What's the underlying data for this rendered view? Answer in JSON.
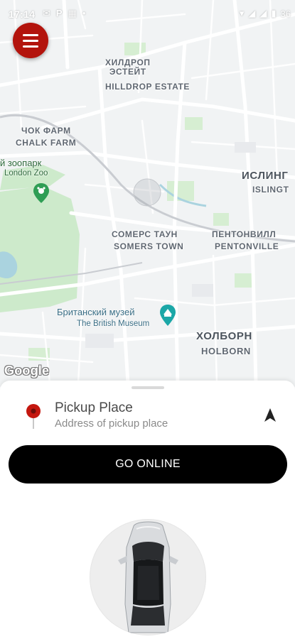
{
  "status_bar": {
    "time": "17:14",
    "left_icons": [
      "mail-icon",
      "parking-icon",
      "calendar-icon",
      "dot-icon"
    ],
    "right_icons": [
      "wifi-icon",
      "signal-icon",
      "battery-icon"
    ],
    "battery": "36"
  },
  "map": {
    "labels": {
      "hilldrop_ru": "ХИЛДРОП\nЭСТЕЙТ",
      "hilldrop_en": "HILLDROP ESTATE",
      "chalk_ru": "ЧОК ФАРМ",
      "chalk_en": "CHALK FARM",
      "zoo_ru": "й зоопарк",
      "zoo_en": "London Zoo",
      "islington_ru": "ИСЛИНГ",
      "islington_en": "ISLINGT",
      "somers_ru": "СОМЕРС ТАУН",
      "somers_en": "SOMERS TOWN",
      "pentonville_ru": "ПЕНТОНВИЛЛ",
      "pentonville_en": "PENTONVILLE",
      "museum_ru": "Британский музей",
      "museum_en": "The British Museum",
      "holborn_ru": "ХОЛБОРН",
      "holborn_en": "HOLBORN"
    },
    "google_logo": "Google",
    "colors": {
      "park": "#cdeacb",
      "water": "#aadaff",
      "road": "#ffffff",
      "land": "#f2f3f4"
    }
  },
  "menu_button": {
    "icon": "hamburger-icon",
    "color": "#b3140d"
  },
  "pickup": {
    "title": "Pickup Place",
    "subtitle": "Address of pickup place",
    "pin_icon": "location-pin-icon",
    "nav_icon": "navigation-arrow-icon"
  },
  "go_online": {
    "label": "GO ONLINE"
  },
  "car": {
    "icon": "car-top-view-icon"
  }
}
